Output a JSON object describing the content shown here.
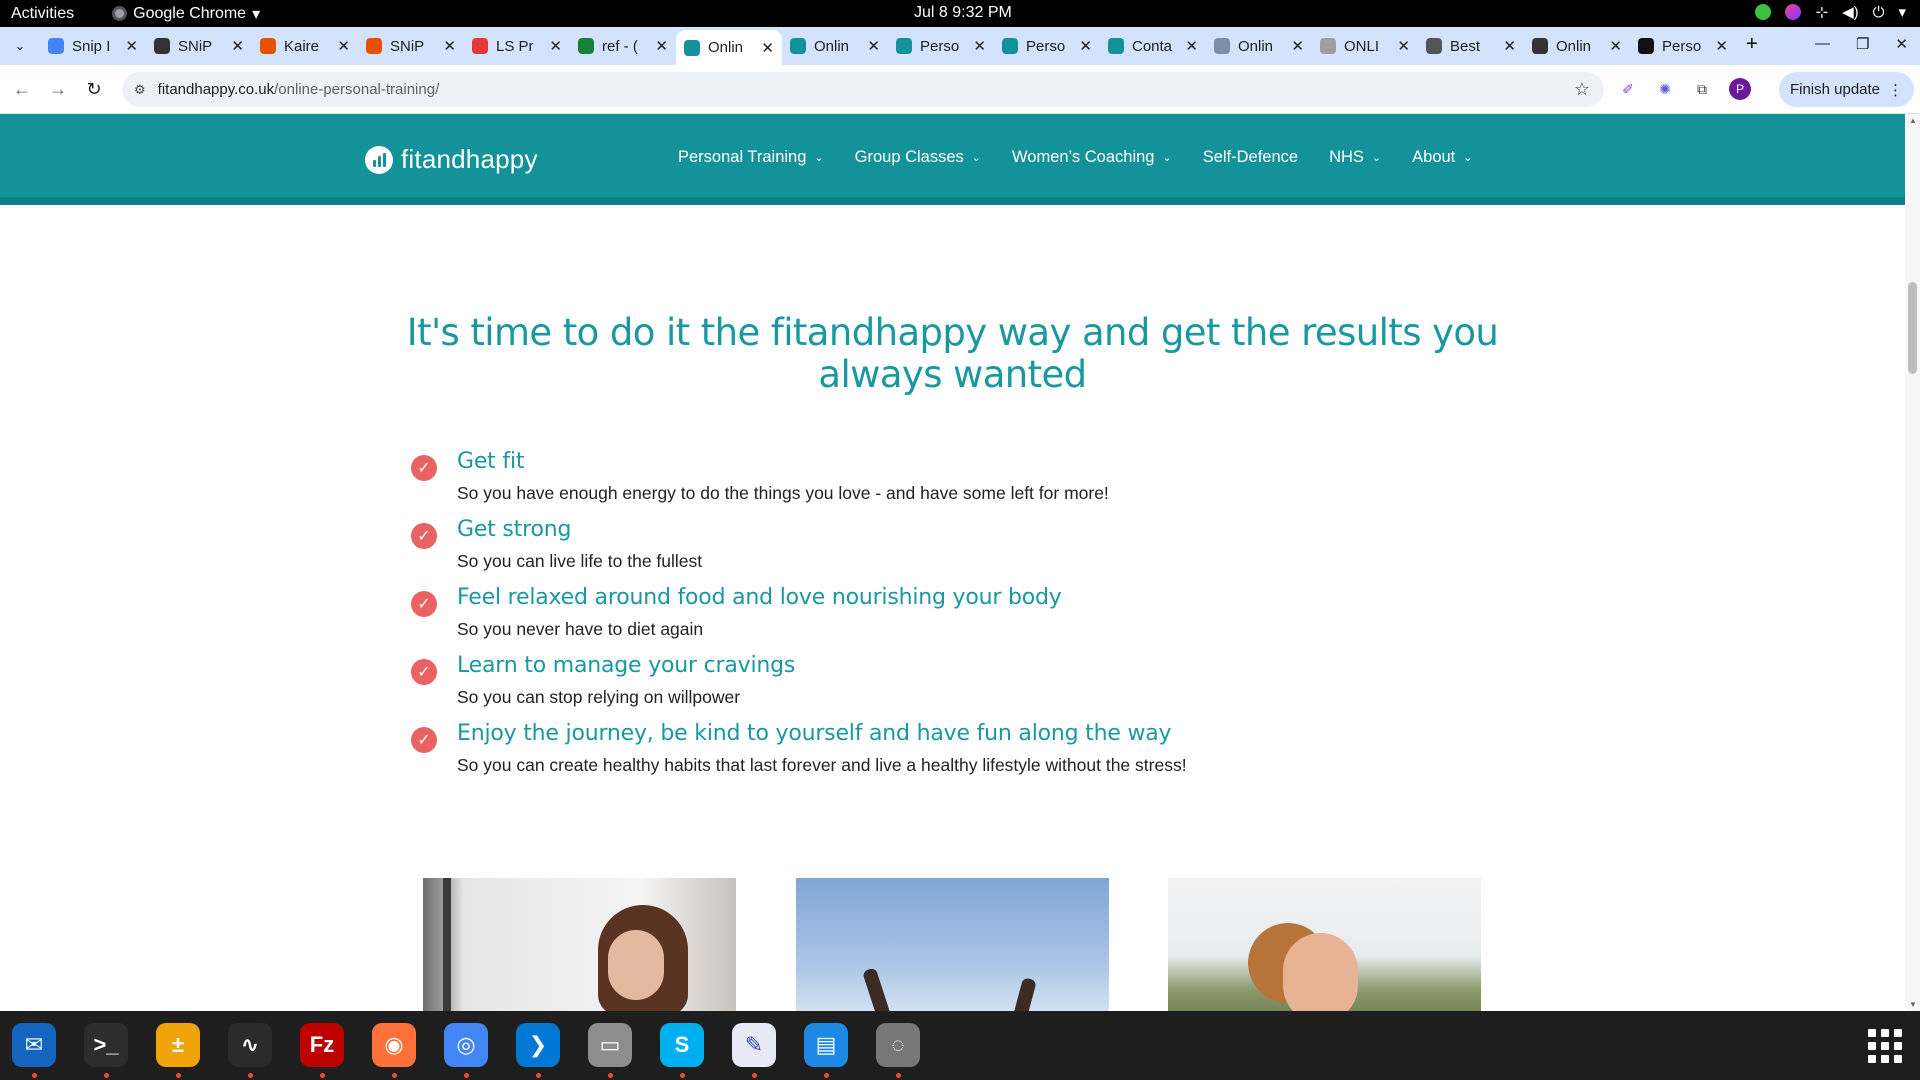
{
  "system_bar": {
    "activities": "Activities",
    "app_name": "Google Chrome",
    "app_menu_arrow": "▾",
    "clock": "Jul 8  9:32 PM"
  },
  "tabs": [
    {
      "title": "Snip I",
      "favicon_color": "#4285f4"
    },
    {
      "title": "SNiP",
      "favicon_color": "#333333"
    },
    {
      "title": "Kaire",
      "favicon_color": "#e65100"
    },
    {
      "title": "SNiP",
      "favicon_color": "#e65100"
    },
    {
      "title": "LS Pr",
      "favicon_color": "#e53935"
    },
    {
      "title": "ref - (",
      "favicon_color": "#188038"
    },
    {
      "title": "Onlin",
      "favicon_color": "#13929a"
    },
    {
      "title": "Onlin",
      "favicon_color": "#13929a"
    },
    {
      "title": "Perso",
      "favicon_color": "#13929a"
    },
    {
      "title": "Perso",
      "favicon_color": "#13929a"
    },
    {
      "title": "Conta",
      "favicon_color": "#13929a"
    },
    {
      "title": "Onlin",
      "favicon_color": "#7b8fa6"
    },
    {
      "title": "ONLI",
      "favicon_color": "#9e9e9e"
    },
    {
      "title": "Best",
      "favicon_color": "#555555"
    },
    {
      "title": "Onlin",
      "favicon_color": "#333333"
    },
    {
      "title": "Perso",
      "favicon_color": "#111111"
    }
  ],
  "active_tab_index": 6,
  "address_bar": {
    "host": "fitandhappy.co.uk",
    "path": "/online-personal-training/"
  },
  "toolbar": {
    "finish_update": "Finish update",
    "avatar_letter": "P"
  },
  "site": {
    "logo_text": "fitandhappy",
    "brand_color": "#13929a",
    "nav": [
      {
        "label": "Personal Training",
        "has_dropdown": true
      },
      {
        "label": "Group Classes",
        "has_dropdown": true
      },
      {
        "label": "Women’s Coaching",
        "has_dropdown": true
      },
      {
        "label": "Self-Defence",
        "has_dropdown": false
      },
      {
        "label": "NHS",
        "has_dropdown": true
      },
      {
        "label": "About",
        "has_dropdown": true
      }
    ],
    "heading": "It's time to do it the fitandhappy way and get the results you always wanted",
    "benefits": [
      {
        "title": "Get fit",
        "desc": "So you have enough energy to do the things you love - and have some left for more!"
      },
      {
        "title": "Get strong",
        "desc": "So you can live life to the fullest"
      },
      {
        "title": "Feel relaxed around food and love nourishing your body",
        "desc": "So you never have to diet again"
      },
      {
        "title": "Learn to manage your cravings",
        "desc": "So you can stop relying on willpower"
      },
      {
        "title": "Enjoy the journey, be kind to yourself and have fun along the way",
        "desc": "So you can create healthy habits that last forever and live a healthy lifestyle without the stress!"
      }
    ],
    "check_color": "#eb6262"
  },
  "dock": [
    {
      "name": "thunderbird",
      "color": "#1565c0",
      "glyph": "✉"
    },
    {
      "name": "terminal",
      "color": "#2d2d2d",
      "glyph": ">_"
    },
    {
      "name": "calculator",
      "color": "#f0a30a",
      "glyph": "±"
    },
    {
      "name": "system-monitor",
      "color": "#2b2b2b",
      "glyph": "∿"
    },
    {
      "name": "filezilla",
      "color": "#bf0000",
      "glyph": "Fz"
    },
    {
      "name": "firefox",
      "color": "#ff7139",
      "glyph": "◉"
    },
    {
      "name": "chrome",
      "color": "#4285f4",
      "glyph": "◎"
    },
    {
      "name": "vscode",
      "color": "#0078d4",
      "glyph": "❯"
    },
    {
      "name": "files",
      "color": "#8d8d8d",
      "glyph": "▭"
    },
    {
      "name": "skype",
      "color": "#00aff0",
      "glyph": "S"
    },
    {
      "name": "text-editor",
      "color": "#e8eaf6",
      "glyph": "✎"
    },
    {
      "name": "libreoffice-writer",
      "color": "#1e88e5",
      "glyph": "▤"
    },
    {
      "name": "disk-utility",
      "color": "#777777",
      "glyph": "◌"
    }
  ]
}
